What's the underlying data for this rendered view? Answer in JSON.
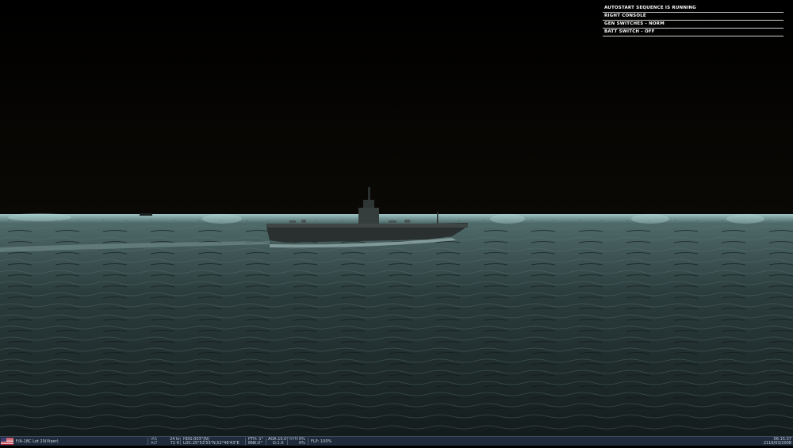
{
  "messages": [
    "AUTOSTART SEQUENCE IS RUNNING",
    "RIGHT CONSOLE",
    "GEN SWITCHES - NORM",
    "BATT SWITCH - OFF"
  ],
  "status": {
    "aircraft": "F/A-18C Lot 20(Viper)",
    "ias_label": "IAS",
    "ias_value": "24 kn",
    "alt_label": "ALT",
    "alt_value": "72 ft",
    "hdg": "HDG:003°(N)",
    "loc": "LOC:25°53'53\"N,52°46'43\"E",
    "pth": "PTH:-1°",
    "bnk": "BNK:0°",
    "aoa": "AOA:10.0°",
    "g": "G:1.0",
    "rpm_label": "RPM",
    "rpm1": "0%",
    "rpm2": "0%",
    "flp": "FLP: 100%",
    "time": "06:15:37",
    "date": "2116/03/2008"
  },
  "colors": {
    "sky": "#000000",
    "sea": "#3f5656",
    "horizon_glow": "#9fc9c8",
    "statusbar": "#1f2b3a",
    "message_text": "#ffffff"
  },
  "icons": {
    "flag": "usa-flag-icon"
  }
}
